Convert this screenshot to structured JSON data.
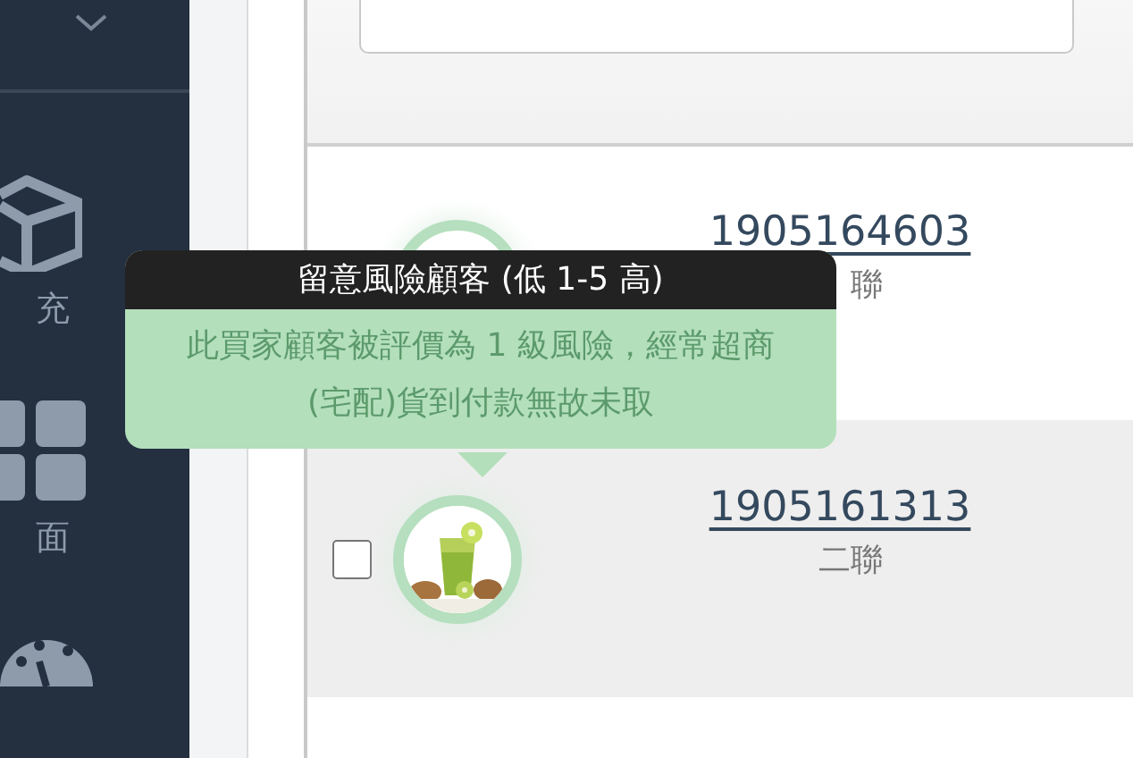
{
  "sidebar": {
    "items": [
      {
        "kind": "cube",
        "label": "充"
      },
      {
        "kind": "grid",
        "label": "面"
      },
      {
        "kind": "gauge"
      }
    ]
  },
  "orders": [
    {
      "number": "1905164603",
      "copy_type": "聯"
    },
    {
      "number": "1905161313",
      "copy_type": "二聯",
      "checked": false
    }
  ],
  "tooltip": {
    "title": "留意風險顧客 (低 1-5 高)",
    "body": "此買家顧客被評價為 1 級風險，經常超商(宅配)貨到付款無故未取"
  }
}
